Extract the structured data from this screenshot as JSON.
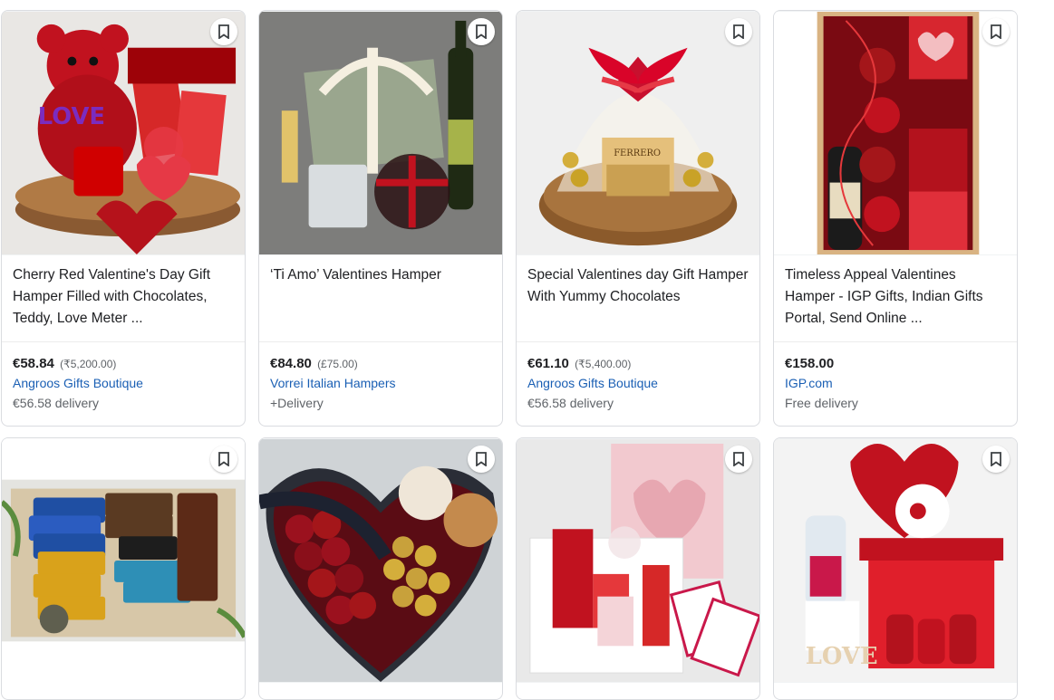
{
  "products": [
    {
      "title": "Cherry Red Valentine's Day Gift Hamper Filled with Chocolates, Teddy, Love Meter ...",
      "price": "€58.84",
      "original_price": "(₹5,200.00)",
      "seller": "Angroos Gifts Boutique",
      "delivery": "€56.58 delivery",
      "image": "red-teddy-basket-photo"
    },
    {
      "title": "‘Ti Amo’ Valentines Hamper",
      "price": "€84.80",
      "original_price": "(£75.00)",
      "seller": "Vorrei Italian Hampers",
      "delivery": "+Delivery",
      "image": "wine-hamper-photo"
    },
    {
      "title": "Special Valentines day Gift Hamper With Yummy Chocolates",
      "price": "€61.10",
      "original_price": "(₹5,400.00)",
      "seller": "Angroos Gifts Boutique",
      "delivery": "€56.58 delivery",
      "image": "ferrero-basket-photo"
    },
    {
      "title": "Timeless Appeal Valentines Hamper - IGP Gifts, Indian Gifts Portal, Send Online ...",
      "price": "€158.00",
      "original_price": "",
      "seller": "IGP.com",
      "delivery": "Free delivery",
      "image": "champagne-box-photo"
    },
    {
      "image": "chocolate-bars-box-photo"
    },
    {
      "image": "roses-heart-box-photo"
    },
    {
      "image": "valentines-gift-box-photo"
    },
    {
      "image": "balloon-gift-box-photo"
    }
  ],
  "colors": {
    "link": "#1a5fb4",
    "border": "#dadce0",
    "text": "#202124",
    "muted": "#5f6368"
  },
  "icons": {
    "bookmark": "bookmark-icon"
  }
}
